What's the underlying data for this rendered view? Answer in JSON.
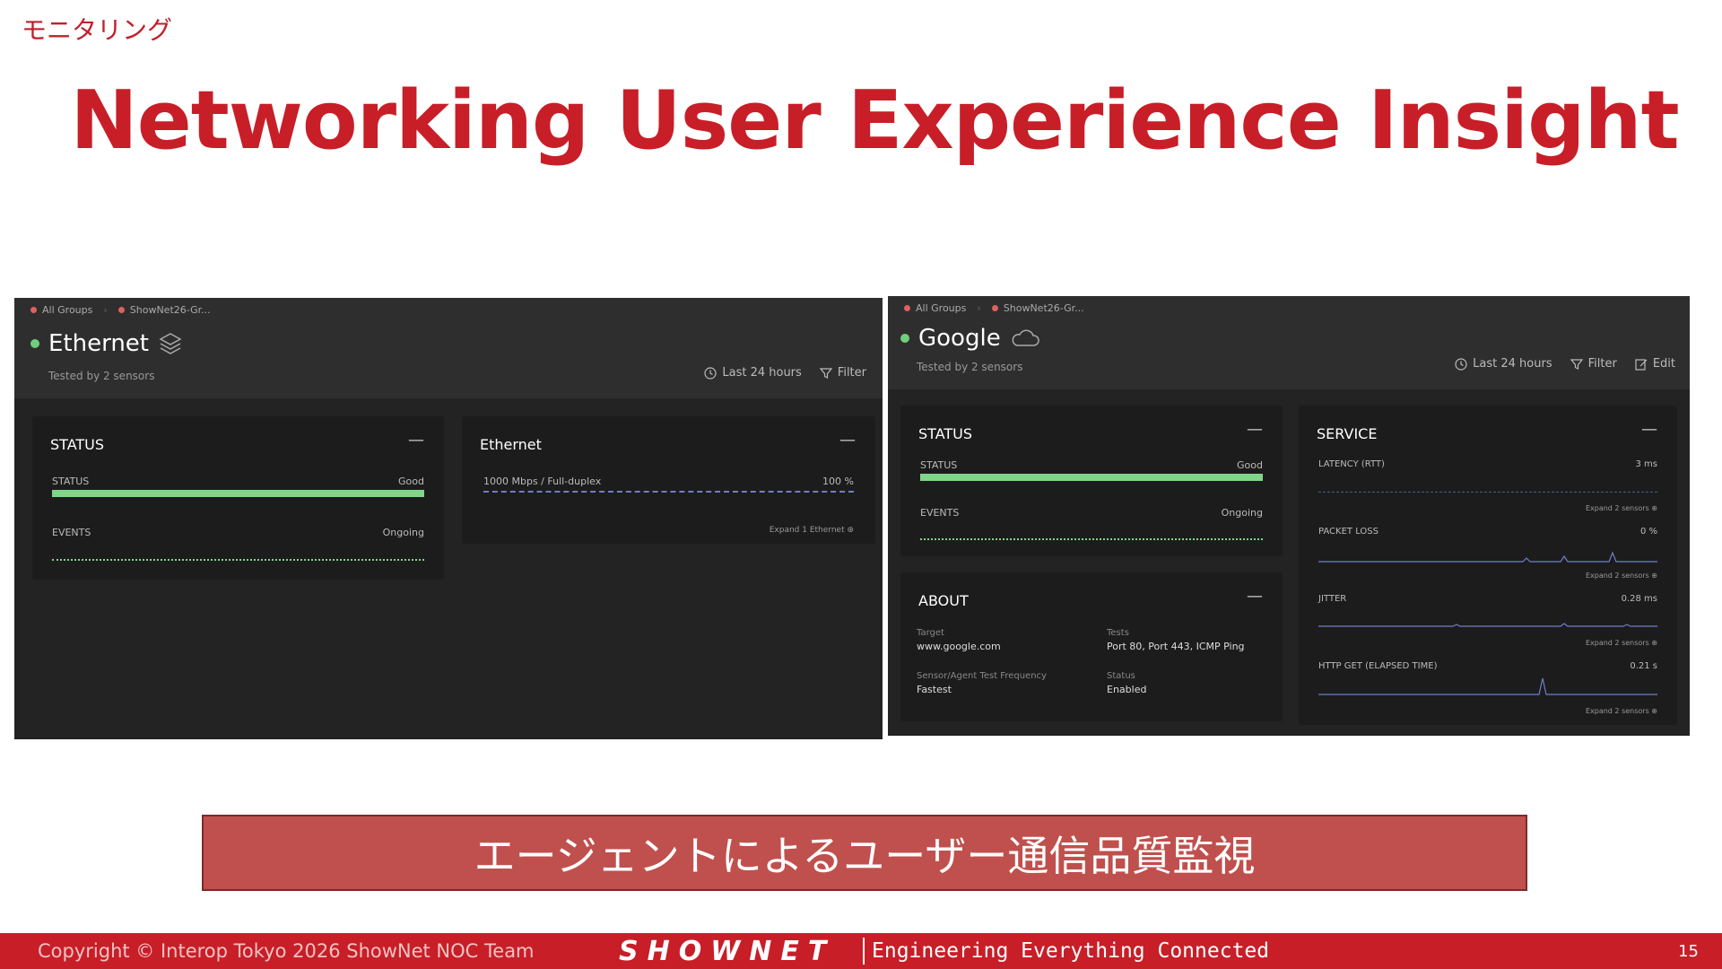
{
  "slide": {
    "section_label": "モニタリング",
    "title": "Networking User Experience Insight",
    "banner_text": "エージェントによるユーザー通信品質監視"
  },
  "left_panel": {
    "breadcrumbs": [
      "All Groups",
      "ShowNet26-Gr..."
    ],
    "device_name": "Ethernet",
    "device_icon": "layers-icon",
    "status_color": "#6fcf7a",
    "subtitle": "Tested by 2 sensors",
    "toolbar": {
      "time_range": "Last 24 hours",
      "filter": "Filter"
    },
    "status_card": {
      "title": "STATUS",
      "collapse": "—",
      "status_label": "STATUS",
      "status_value": "Good",
      "events_label": "EVENTS",
      "events_value": "Ongoing"
    },
    "ethernet_card": {
      "title": "Ethernet",
      "collapse": "—",
      "link_label": "1000 Mbps / Full-duplex",
      "link_value": "100 %",
      "expand": "Expand 1 Ethernet ⊕"
    }
  },
  "right_panel": {
    "breadcrumbs": [
      "All Groups",
      "ShowNet26-Gr..."
    ],
    "device_name": "Google",
    "device_icon": "cloud-icon",
    "status_color": "#6fcf7a",
    "subtitle": "Tested by 2 sensors",
    "toolbar": {
      "time_range": "Last 24 hours",
      "filter": "Filter",
      "edit": "Edit"
    },
    "status_card": {
      "title": "STATUS",
      "collapse": "—",
      "status_label": "STATUS",
      "status_value": "Good",
      "events_label": "EVENTS",
      "events_value": "Ongoing"
    },
    "about_card": {
      "title": "ABOUT",
      "collapse": "—",
      "target_label": "Target",
      "target_value": "www.google.com",
      "tests_label": "Tests",
      "tests_value": "Port 80, Port 443, ICMP Ping",
      "freq_label": "Sensor/Agent Test Frequency",
      "freq_value": "Fastest",
      "status_label": "Status",
      "status_value": "Enabled"
    },
    "service_card": {
      "title": "SERVICE",
      "collapse": "—",
      "metrics": [
        {
          "label": "LATENCY (RTT)",
          "value": "3 ms",
          "expand": "Expand 2 sensors ⊕"
        },
        {
          "label": "PACKET LOSS",
          "value": "0 %",
          "expand": "Expand 2 sensors ⊕"
        },
        {
          "label": "JITTER",
          "value": "0.28 ms",
          "expand": "Expand 2 sensors ⊕"
        },
        {
          "label": "HTTP GET (ELAPSED TIME)",
          "value": "0.21 s",
          "expand": "Expand 2 sensors ⊕"
        }
      ]
    }
  },
  "footer": {
    "copyright": "Copyright © Interop Tokyo 2026 ShowNet NOC Team",
    "brand": "SHOWNET",
    "tagline": "Engineering Everything Connected",
    "page_number": "15"
  }
}
